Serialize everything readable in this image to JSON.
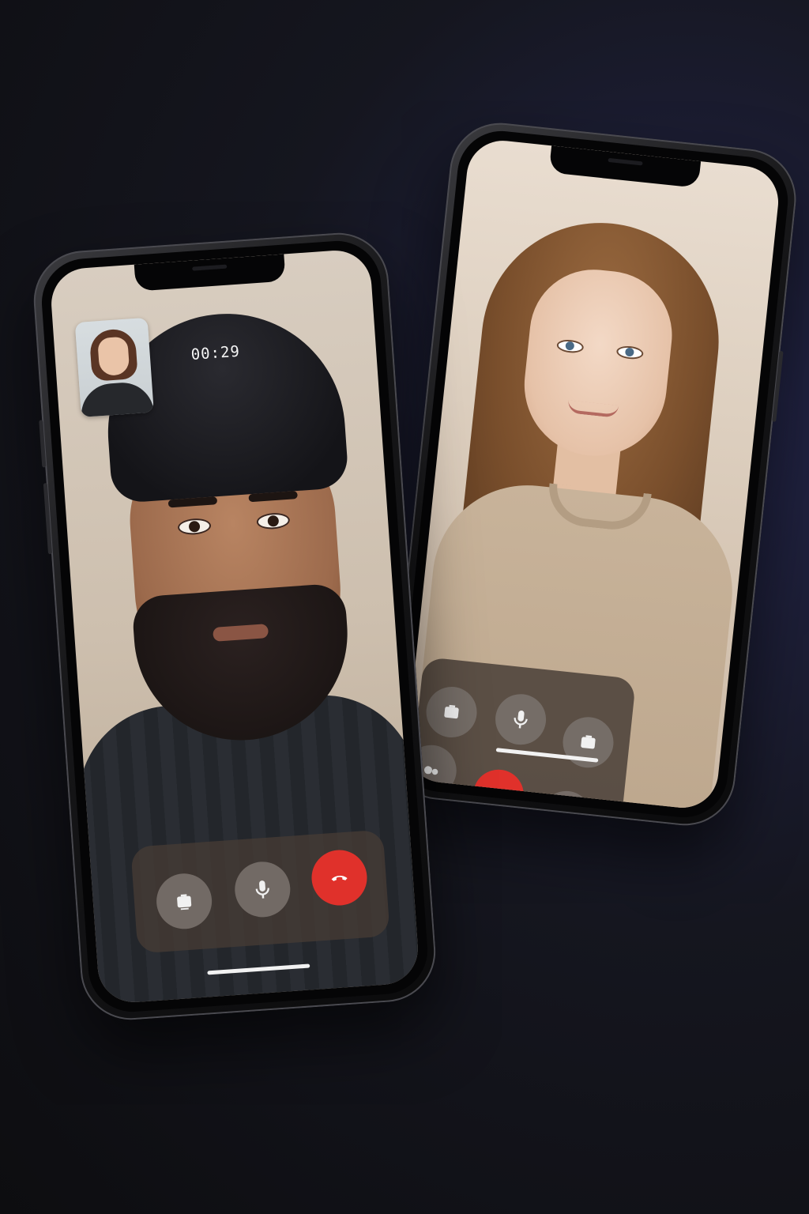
{
  "call": {
    "timer": "00:29"
  },
  "controls_left": [
    {
      "icon": "camera-flip-icon",
      "label": "camera"
    },
    {
      "icon": "microphone-icon",
      "label": "mute"
    },
    {
      "icon": "end-call-icon",
      "label": "end"
    }
  ],
  "controls_right": [
    {
      "icon": "camera-flip-icon",
      "label": "camera"
    },
    {
      "icon": "microphone-icon",
      "label": "mute"
    },
    {
      "icon": "camera-flip-icon",
      "label": "camera"
    },
    {
      "icon": "effects-icon",
      "label": "effects"
    },
    {
      "icon": "end-call-icon",
      "label": "end"
    },
    {
      "icon": "speaker-icon",
      "label": "speaker"
    }
  ],
  "colors": {
    "end_call": "#e0312b",
    "control_bg": "#78706a",
    "panel_bg": "#443a34"
  }
}
